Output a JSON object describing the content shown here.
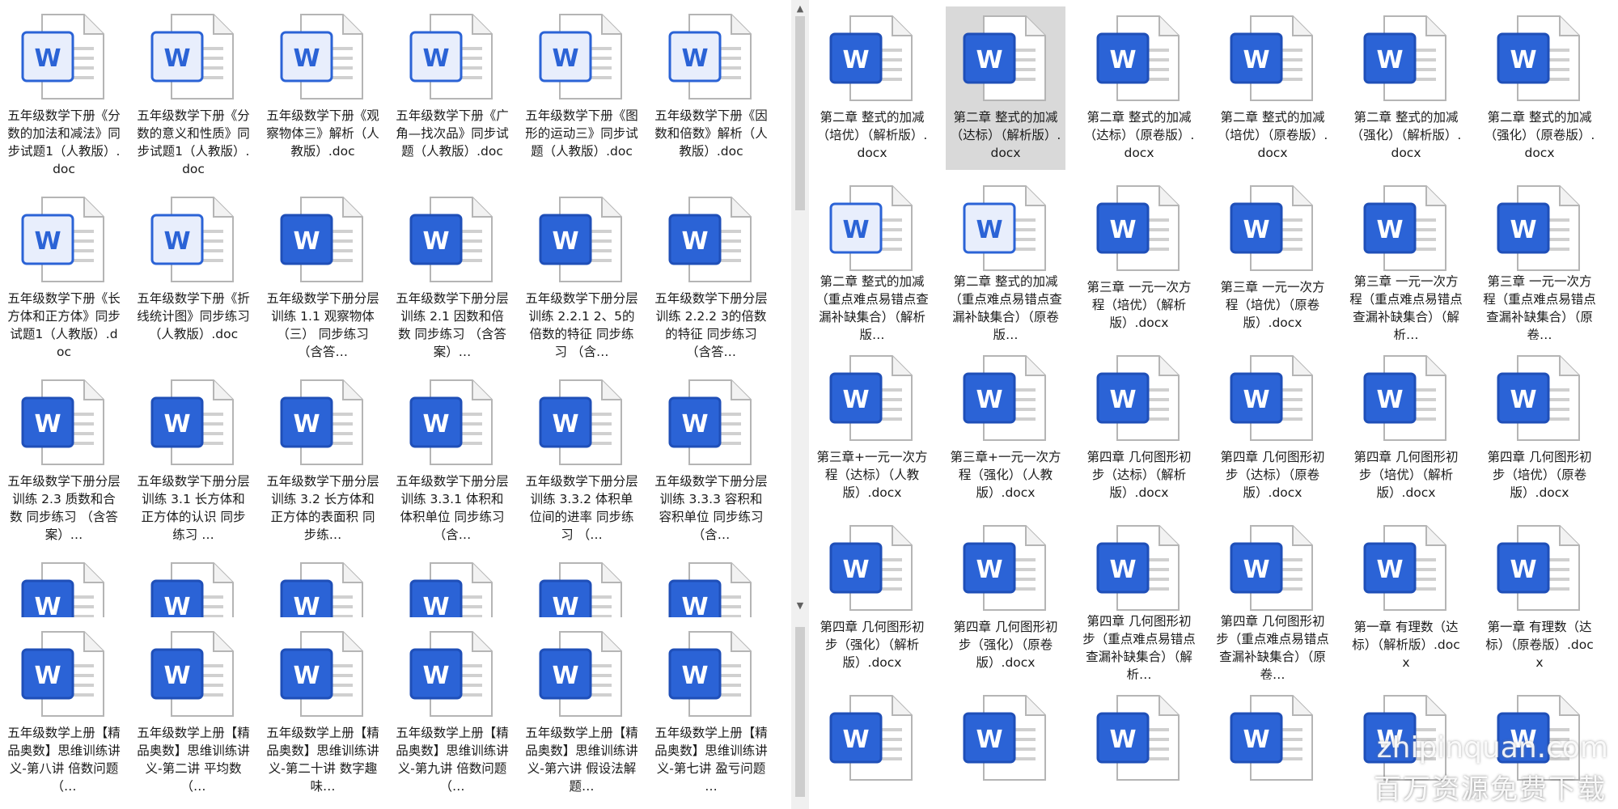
{
  "icon_glyph": "W",
  "colors": {
    "word_blue": "#2b63d6",
    "selection": "#d9d9d9",
    "scrollbar": "#cdcdcd"
  },
  "left_pane": {
    "files": [
      {
        "label": "五年级数学下册《分数的加法和减法》同步试题1（人教版）.doc",
        "icon": "word-doc-legacy-icon"
      },
      {
        "label": "五年级数学下册《分数的意义和性质》同步试题1（人教版）.doc",
        "icon": "word-doc-legacy-icon"
      },
      {
        "label": "五年级数学下册《观察物体三》解析（人教版）.doc",
        "icon": "word-doc-legacy-icon"
      },
      {
        "label": "五年级数学下册《广角—找次品》同步试题（人教版）.doc",
        "icon": "word-doc-legacy-icon"
      },
      {
        "label": "五年级数学下册《图形的运动三》同步试题（人教版）.doc",
        "icon": "word-doc-legacy-icon"
      },
      {
        "label": "五年级数学下册《因数和倍数》解析（人教版）.doc",
        "icon": "word-doc-legacy-icon"
      },
      {
        "label": "五年级数学下册《长方体和正方体》同步试题1（人教版）.doc",
        "icon": "word-doc-legacy-icon"
      },
      {
        "label": "五年级数学下册《折线统计图》同步练习（人教版）.doc",
        "icon": "word-doc-legacy-icon"
      },
      {
        "label": "五年级数学下册分层训练 1.1 观察物体（三） 同步练习 （含答…",
        "icon": "word-docx-icon"
      },
      {
        "label": "五年级数学下册分层训练 2.1 因数和倍数 同步练习 （含答案）…",
        "icon": "word-docx-icon"
      },
      {
        "label": "五年级数学下册分层训练 2.2.1 2、5的倍数的特征 同步练习 （含…",
        "icon": "word-docx-icon"
      },
      {
        "label": "五年级数学下册分层训练 2.2.2 3的倍数的特征 同步练习 （含答…",
        "icon": "word-docx-icon"
      },
      {
        "label": "五年级数学下册分层训练 2.3 质数和合数 同步练习 （含答案）…",
        "icon": "word-docx-icon"
      },
      {
        "label": "五年级数学下册分层训练 3.1 长方体和正方体的认识 同步练习 …",
        "icon": "word-docx-icon"
      },
      {
        "label": "五年级数学下册分层训练 3.2 长方体和正方体的表面积 同步练…",
        "icon": "word-docx-icon"
      },
      {
        "label": "五年级数学下册分层训练 3.3.1 体积和体积单位 同步练习 （含…",
        "icon": "word-docx-icon"
      },
      {
        "label": "五年级数学下册分层训练 3.3.2 体积单位间的进率 同步练习 （…",
        "icon": "word-docx-icon"
      },
      {
        "label": "五年级数学下册分层训练 3.3.3 容积和容积单位 同步练习 （含…",
        "icon": "word-docx-icon"
      }
    ]
  },
  "left_bottom_pane": {
    "files": [
      {
        "label": "五年级数学上册【精品奥数】思维训练讲义-第八讲 倍数问题（…",
        "icon": "word-docx-icon"
      },
      {
        "label": "五年级数学上册【精品奥数】思维训练讲义-第二讲 平均数 （…",
        "icon": "word-docx-icon"
      },
      {
        "label": "五年级数学上册【精品奥数】思维训练讲义-第二十讲 数字趣味…",
        "icon": "word-docx-icon"
      },
      {
        "label": "五年级数学上册【精品奥数】思维训练讲义-第九讲 倍数问题（…",
        "icon": "word-docx-icon"
      },
      {
        "label": "五年级数学上册【精品奥数】思维训练讲义-第六讲 假设法解题…",
        "icon": "word-docx-icon"
      },
      {
        "label": "五年级数学上册【精品奥数】思维训练讲义-第七讲 盈亏问题 …",
        "icon": "word-docx-icon"
      }
    ]
  },
  "right_pane": {
    "files": [
      {
        "label": "第二章 整式的加减（培优）（解析版）.docx",
        "icon": "word-docx-icon"
      },
      {
        "label": "第二章 整式的加减（达标）（解析版）.docx",
        "icon": "word-docx-icon",
        "selected": true
      },
      {
        "label": "第二章 整式的加减（达标）（原卷版）.docx",
        "icon": "word-docx-icon"
      },
      {
        "label": "第二章 整式的加减（培优）（原卷版）.docx",
        "icon": "word-docx-icon"
      },
      {
        "label": "第二章 整式的加减（强化）（解析版）.docx",
        "icon": "word-docx-icon"
      },
      {
        "label": "第二章 整式的加减（强化）（原卷版）.docx",
        "icon": "word-docx-icon"
      },
      {
        "label": "第二章 整式的加减（重点难点易错点查漏补缺集合）（解析版…",
        "icon": "word-doc-legacy-icon"
      },
      {
        "label": "第二章 整式的加减（重点难点易错点查漏补缺集合）（原卷版…",
        "icon": "word-doc-legacy-icon"
      },
      {
        "label": "第三章 一元一次方程（培优）（解析版）.docx",
        "icon": "word-docx-icon"
      },
      {
        "label": "第三章 一元一次方程（培优）（原卷版）.docx",
        "icon": "word-docx-icon"
      },
      {
        "label": "第三章 一元一次方程（重点难点易错点查漏补缺集合）（解析…",
        "icon": "word-docx-icon"
      },
      {
        "label": "第三章 一元一次方程（重点难点易错点查漏补缺集合）（原卷…",
        "icon": "word-docx-icon"
      },
      {
        "label": "第三章+一元一次方程（达标）（人教版）.docx",
        "icon": "word-docx-icon"
      },
      {
        "label": "第三章+一元一次方程（强化）（人教版）.docx",
        "icon": "word-docx-icon"
      },
      {
        "label": "第四章 几何图形初步（达标）（解析版）.docx",
        "icon": "word-docx-icon"
      },
      {
        "label": "第四章 几何图形初步（达标）（原卷版）.docx",
        "icon": "word-docx-icon"
      },
      {
        "label": "第四章 几何图形初步（培优）（解析版）.docx",
        "icon": "word-docx-icon"
      },
      {
        "label": "第四章 几何图形初步（培优）（原卷版）.docx",
        "icon": "word-docx-icon"
      },
      {
        "label": "第四章 几何图形初步（强化）（解析版）.docx",
        "icon": "word-docx-icon"
      },
      {
        "label": "第四章 几何图形初步（强化）（原卷版）.docx",
        "icon": "word-docx-icon"
      },
      {
        "label": "第四章 几何图形初步（重点难点易错点查漏补缺集合）（解析…",
        "icon": "word-docx-icon"
      },
      {
        "label": "第四章 几何图形初步（重点难点易错点查漏补缺集合）（原卷…",
        "icon": "word-docx-icon"
      },
      {
        "label": "第一章 有理数（达标）（解析版）.docx",
        "icon": "word-docx-icon"
      },
      {
        "label": "第一章 有理数（达标）（原卷版）.docx",
        "icon": "word-docx-icon"
      }
    ]
  },
  "watermark": {
    "line1": "zhipinquan.com",
    "line2": "百万资源免费下载"
  }
}
